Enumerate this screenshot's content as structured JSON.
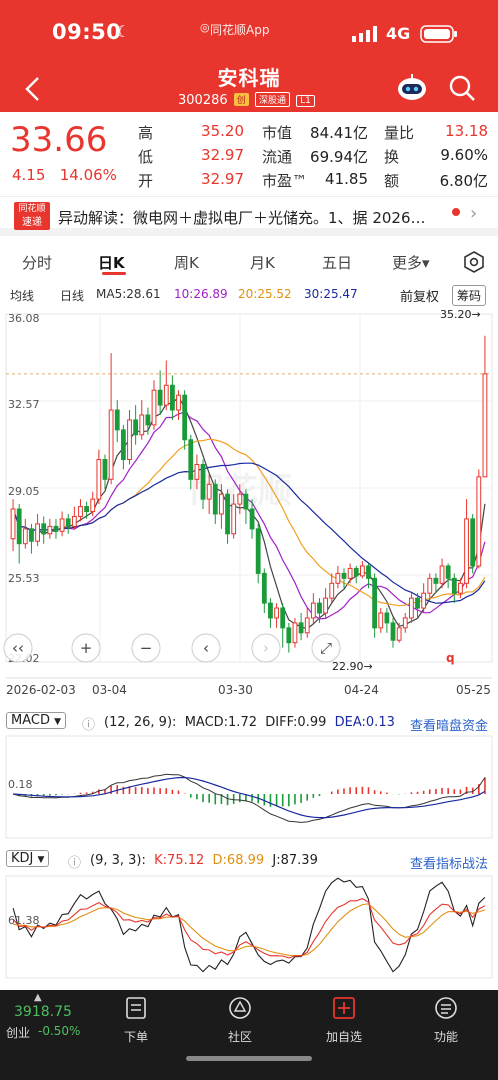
{
  "status": {
    "time": "09:50",
    "app": "同花顺App",
    "network": "4G"
  },
  "header": {
    "title": "安科瑞",
    "code": "300286",
    "tags": [
      "创",
      "深股通",
      "L1"
    ]
  },
  "quote": {
    "price": "33.66",
    "change": "4.15",
    "change_pct": "14.06%",
    "fields": [
      {
        "label": "高",
        "value": "35.20",
        "color": "red"
      },
      {
        "label": "低",
        "value": "32.97",
        "color": "red"
      },
      {
        "label": "开",
        "value": "32.97",
        "color": "red"
      },
      {
        "label": "市值",
        "value": "84.41亿",
        "color": "dark"
      },
      {
        "label": "流通",
        "value": "69.94亿",
        "color": "dark"
      },
      {
        "label": "市盈™",
        "value": "41.85",
        "color": "dark"
      },
      {
        "label": "量比",
        "value": "13.18",
        "color": "red"
      },
      {
        "label": "换",
        "value": "9.60%",
        "color": "dark"
      },
      {
        "label": "额",
        "value": "6.80亿",
        "color": "dark"
      }
    ]
  },
  "news": {
    "badge_line1": "同花顺",
    "badge_line2": "速递",
    "text": "异动解读：微电网＋虚拟电厂＋光储充。1、据 2026…"
  },
  "tabs": [
    "分时",
    "日K",
    "周K",
    "月K",
    "五日",
    "更多▾"
  ],
  "ma_row": {
    "mode": "均线",
    "period": "日线",
    "ma5": "MA5:28.61",
    "ma10": "10:26.89",
    "ma20": "20:25.52",
    "ma30": "30:25.47",
    "adjust": "前复权",
    "chips": "筹码"
  },
  "kline": {
    "y_labels": [
      "36.08",
      "32.57",
      "29.05",
      "25.53",
      "22.02"
    ],
    "dates": [
      "2026-02-03",
      "03-04",
      "03-30",
      "04-24",
      "05-25"
    ],
    "high_mark": "35.20→",
    "low_mark": "22.90→"
  },
  "macd": {
    "name": "MACD",
    "params": "(12, 26, 9):",
    "macd": "MACD:1.72",
    "diff": "DIFF:0.99",
    "dea": "DEA:0.13",
    "link": "查看暗盘资金",
    "axis": "0.18"
  },
  "kdj": {
    "name": "KDJ",
    "params": "(9, 3, 3):",
    "k": "K:75.12",
    "d": "D:68.99",
    "j": "J:87.39",
    "link": "查看指标战法",
    "axis": "61.38"
  },
  "bottom": {
    "index_value": "3918.75",
    "index_name": "创业",
    "index_change": "-0.50%",
    "items": [
      "下单",
      "社区",
      "加自选",
      "功能"
    ]
  },
  "chart_data": {
    "type": "candlestick",
    "ylim": [
      22.02,
      36.08
    ],
    "candles": [
      [
        27.0,
        28.2,
        26.5,
        28.6
      ],
      [
        28.2,
        26.8,
        26.0,
        28.4
      ],
      [
        26.8,
        27.4,
        26.6,
        27.8
      ],
      [
        27.4,
        26.9,
        26.4,
        27.6
      ],
      [
        26.9,
        27.6,
        26.7,
        28.0
      ],
      [
        27.6,
        27.2,
        26.8,
        27.9
      ],
      [
        27.2,
        27.5,
        27.0,
        27.8
      ],
      [
        27.5,
        27.3,
        27.0,
        27.8
      ],
      [
        27.3,
        27.8,
        27.1,
        28.1
      ],
      [
        27.8,
        27.5,
        27.2,
        28.0
      ],
      [
        27.5,
        27.9,
        27.4,
        28.3
      ],
      [
        27.9,
        28.3,
        27.7,
        28.6
      ],
      [
        28.3,
        28.1,
        27.8,
        28.5
      ],
      [
        28.1,
        28.6,
        27.9,
        28.9
      ],
      [
        28.6,
        30.2,
        28.4,
        30.6
      ],
      [
        30.2,
        29.4,
        29.0,
        30.4
      ],
      [
        29.4,
        32.2,
        29.2,
        34.5
      ],
      [
        32.2,
        31.4,
        30.9,
        32.6
      ],
      [
        31.4,
        30.2,
        29.8,
        31.6
      ],
      [
        30.2,
        31.8,
        30.0,
        32.2
      ],
      [
        31.8,
        31.2,
        30.8,
        32.4
      ],
      [
        31.2,
        32.0,
        31.0,
        32.6
      ],
      [
        32.0,
        31.6,
        31.2,
        32.3
      ],
      [
        31.6,
        33.0,
        31.4,
        33.4
      ],
      [
        33.0,
        32.4,
        32.0,
        33.8
      ],
      [
        32.4,
        33.2,
        32.2,
        34.2
      ],
      [
        33.2,
        32.2,
        31.8,
        33.6
      ],
      [
        32.2,
        32.8,
        31.8,
        33.0
      ],
      [
        32.8,
        31.0,
        30.6,
        33.0
      ],
      [
        31.0,
        29.4,
        29.0,
        31.2
      ],
      [
        29.4,
        30.0,
        29.0,
        30.4
      ],
      [
        30.0,
        28.6,
        28.2,
        30.2
      ],
      [
        28.6,
        29.2,
        28.0,
        29.6
      ],
      [
        29.2,
        28.0,
        27.6,
        29.4
      ],
      [
        28.0,
        28.8,
        27.4,
        29.2
      ],
      [
        28.8,
        27.2,
        26.8,
        29.0
      ],
      [
        27.2,
        28.4,
        27.0,
        28.8
      ],
      [
        28.4,
        28.8,
        28.0,
        29.2
      ],
      [
        28.8,
        28.2,
        27.6,
        29.0
      ],
      [
        28.2,
        27.4,
        27.0,
        28.6
      ],
      [
        27.4,
        25.6,
        25.2,
        27.6
      ],
      [
        25.6,
        24.4,
        24.0,
        25.8
      ],
      [
        24.4,
        23.8,
        23.4,
        24.6
      ],
      [
        23.8,
        24.2,
        23.4,
        24.4
      ],
      [
        24.2,
        23.4,
        22.6,
        24.4
      ],
      [
        23.4,
        22.8,
        22.4,
        23.6
      ],
      [
        22.8,
        23.6,
        22.6,
        23.8
      ],
      [
        23.6,
        23.2,
        22.9,
        24.0
      ],
      [
        23.2,
        23.8,
        23.0,
        24.2
      ],
      [
        23.8,
        24.4,
        23.6,
        24.8
      ],
      [
        24.4,
        24.0,
        23.6,
        24.6
      ],
      [
        24.0,
        24.6,
        23.8,
        25.0
      ],
      [
        24.6,
        25.2,
        24.4,
        25.6
      ],
      [
        25.2,
        25.6,
        25.0,
        25.9
      ],
      [
        25.6,
        25.4,
        25.0,
        25.8
      ],
      [
        25.4,
        25.8,
        25.2,
        26.0
      ],
      [
        25.8,
        25.5,
        25.2,
        25.9
      ],
      [
        25.5,
        25.9,
        25.4,
        26.1
      ],
      [
        25.9,
        25.4,
        25.0,
        26.0
      ],
      [
        25.4,
        23.4,
        23.0,
        25.6
      ],
      [
        23.4,
        24.0,
        23.2,
        24.2
      ],
      [
        24.0,
        23.6,
        23.2,
        24.2
      ],
      [
        23.6,
        22.9,
        22.6,
        23.8
      ],
      [
        22.9,
        23.4,
        22.8,
        23.6
      ],
      [
        23.4,
        23.8,
        23.2,
        24.0
      ],
      [
        23.8,
        24.6,
        23.6,
        24.8
      ],
      [
        24.6,
        24.2,
        23.8,
        24.8
      ],
      [
        24.2,
        24.8,
        24.0,
        25.2
      ],
      [
        24.8,
        25.4,
        24.6,
        25.6
      ],
      [
        25.4,
        25.2,
        24.8,
        25.6
      ],
      [
        25.2,
        25.9,
        25.0,
        26.2
      ],
      [
        25.9,
        25.4,
        25.0,
        26.0
      ],
      [
        25.4,
        24.8,
        24.4,
        25.6
      ],
      [
        24.8,
        25.2,
        24.6,
        25.4
      ],
      [
        25.2,
        27.8,
        25.0,
        28.6
      ],
      [
        27.8,
        25.9,
        25.6,
        28.0
      ],
      [
        25.9,
        29.5,
        25.8,
        29.8
      ],
      [
        29.5,
        33.66,
        32.97,
        35.2
      ]
    ],
    "series": [
      {
        "name": "MA5",
        "color": "#444444"
      },
      {
        "name": "MA10",
        "color": "#a020c8"
      },
      {
        "name": "MA20",
        "color": "#f0a020"
      },
      {
        "name": "MA30",
        "color": "#1a2aa0"
      }
    ]
  }
}
